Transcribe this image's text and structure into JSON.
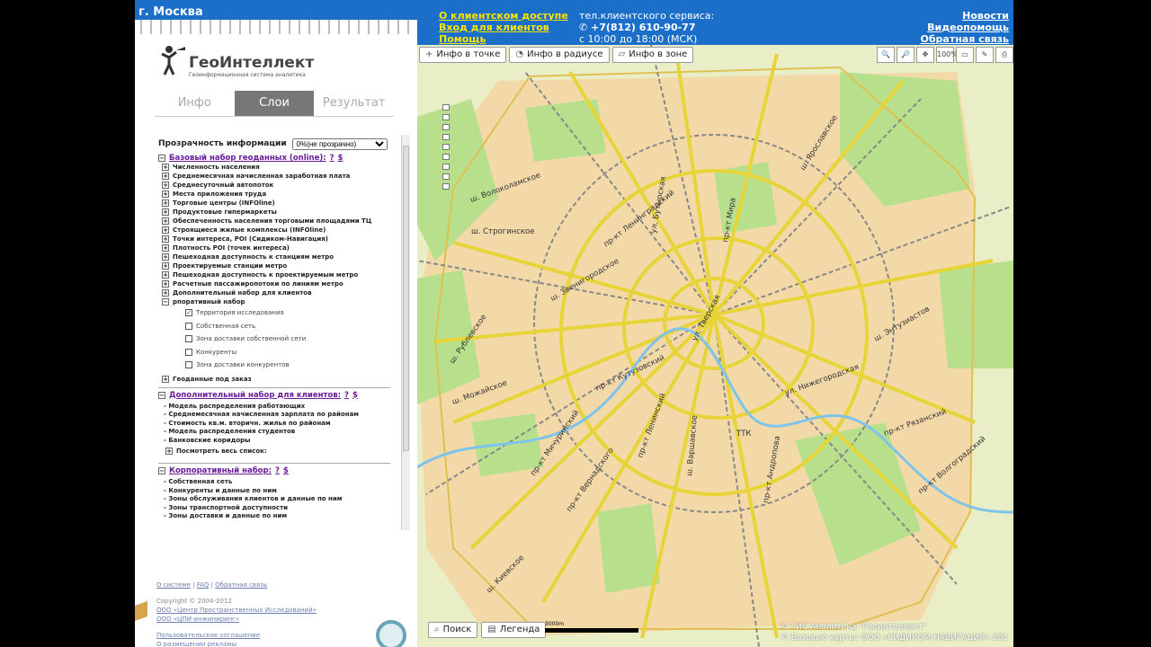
{
  "header": {
    "city": "г. Москва",
    "links": [
      "О клиентском доступе",
      "Вход для клиентов",
      "Помощь"
    ],
    "phone_label": "тел.клиентского сервиса:",
    "phone": "+7(812) 610-90-77",
    "hours": "с 10:00 до 18:00 (МСК)",
    "right_links": [
      "Новости",
      "Видеопомощь",
      "Обратная связь"
    ]
  },
  "logo": {
    "title": "ГеоИнтеллект",
    "subtitle": "Геоинформационная система аналитика"
  },
  "tabs": [
    {
      "label": "Инфо",
      "active": false
    },
    {
      "label": "Слои",
      "active": true
    },
    {
      "label": "Результат",
      "active": false
    }
  ],
  "panel": {
    "opacity_label": "Прозрачность информации",
    "opacity_value": "0%(не прозрачно)",
    "base_group": {
      "title": "Базовый набор геоданных (online):",
      "q": "?",
      "s": "$"
    },
    "base_items": [
      "Численность населения",
      "Среднемесячная начисленная заработная плата",
      "Среднесуточный автопоток",
      "Места приложения труда",
      "Торговые центры (INFOline)",
      "Продуктовые гипермаркеты",
      "Обеспеченность населения торговыми площадями ТЦ",
      "Строящиеся жилые комплексы (INFOline)",
      "Точки интереса, POI (Сидиком-Навигация)",
      "Плотность POI (точек интереса)",
      "Пешеходная доступность к станциям метро",
      "Проектируемые станции метро",
      "Пешеходная доступность к проектируемым метро",
      "Расчетные пассажиропотоки по линиям метро",
      "Дополнительный набор для клиентов",
      "рпоративный набор"
    ],
    "corp_items": [
      {
        "label": "Территория исследования",
        "checked": true
      },
      {
        "label": "Собственная сеть",
        "checked": false
      },
      {
        "label": "Зона доставки собственной сети",
        "checked": false
      },
      {
        "label": "Конкуренты",
        "checked": false
      },
      {
        "label": "Зона доставки конкурентов",
        "checked": false
      }
    ],
    "order_item": "Геоданные под заказ",
    "extra_group": {
      "title": "Дополнительный набор для клиентов:",
      "q": "?",
      "s": "$"
    },
    "extra_items": [
      "- Модель распределения работающих",
      "- Среднемесячная начисленная зарплата по районам",
      "- Стоимость кв.м. вторичн. жилья по районам",
      "- Модель распределения студентов",
      "- Банковские коридоры"
    ],
    "extra_more": "Посмотреть весь список:",
    "corp_group": {
      "title": "Корпоративный набор:",
      "q": "?",
      "s": "$"
    },
    "corp_list": [
      "- Собственная сеть",
      "- Конкуренты и данные по ним",
      "- Зоны обслуживания клиентов и данные по ним",
      "- Зоны транспортной доступности",
      "- Зоны доставки и данные по ним"
    ]
  },
  "footer": {
    "links": [
      "О системе",
      "FAQ",
      "Обратная связь"
    ],
    "copyright": "Copyright © 2004-2012",
    "orgs": [
      "ООО «Центр Пространственных Исследований»",
      "ООО «ЦПИ-инжиниринг»"
    ],
    "legal": [
      "Пользовательское соглашение",
      "О размещении рекламы"
    ]
  },
  "map": {
    "tools": [
      "Инфо в точке",
      "Инфо в радиусе",
      "Инфо в зоне"
    ],
    "zoom_text": "100%",
    "bottom_buttons": [
      "Поиск",
      "Легенда"
    ],
    "scale": "3000m",
    "copyright": [
      "© ГИС Аналитика \"Геоинтеллект\"",
      "© Базовые карты: ООО «СИДИКОМ НАВИГАЦИЯ» 201"
    ],
    "labels": [
      "ш. Строгинское",
      "ш. Волоколамское",
      "пр-кт Ленинградский",
      "ул. Тверская",
      "пр-кт Мира",
      "ш. Ярославское",
      "ш. Энтузиастов",
      "ул. Нижегородская",
      "пр-кт Кутузовский",
      "ш. Рублевское",
      "ш. Можайское",
      "ш. Звенигородское",
      "пр-кт Вернадского",
      "пр-кт Ленинский",
      "пр-кт Андропова",
      "пр-кт Рязанский",
      "пр-кт Волгоградский",
      "ТТК",
      "ш. Киевское",
      "ул. Бутырская",
      "ш. Варшавское",
      "пр-кт Мичуринский"
    ]
  }
}
